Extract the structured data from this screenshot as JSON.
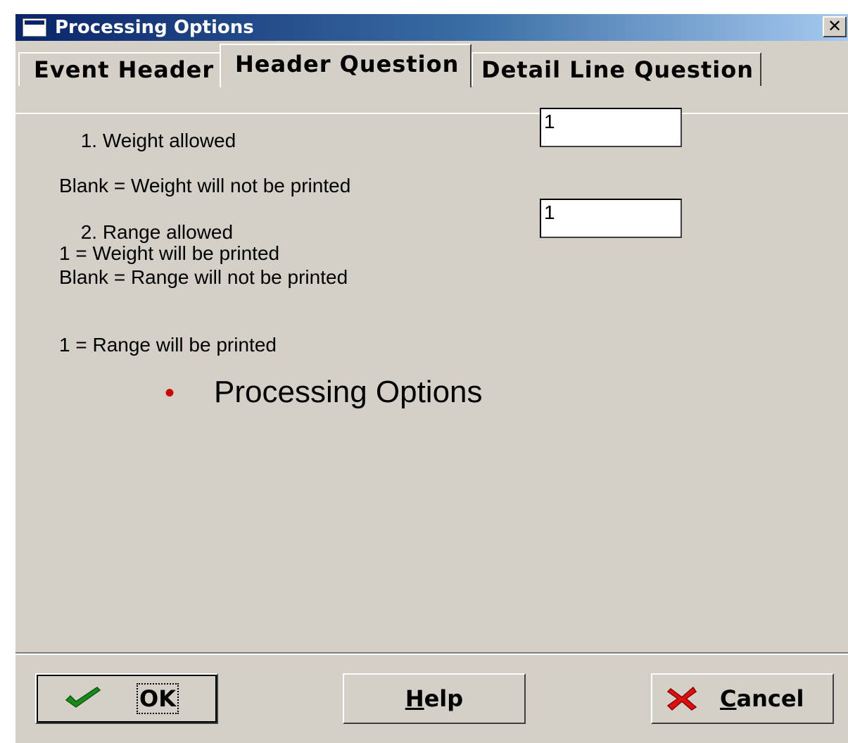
{
  "window": {
    "title": "Processing Options",
    "close_glyph": "✕"
  },
  "tabs": [
    {
      "label": "Event Header",
      "selected": false
    },
    {
      "label": "Header Question",
      "selected": true
    },
    {
      "label": "Detail Line Question",
      "selected": false
    }
  ],
  "options": [
    {
      "title": "1. Weight allowed",
      "line1": "Blank = Weight will not be printed",
      "line2": "1 = Weight will be printed",
      "value": "1"
    },
    {
      "title": "2. Range allowed",
      "line1": "Blank = Range will not be printed",
      "line2": "1 = Range will be printed",
      "value": "1"
    }
  ],
  "overlay": {
    "bullet": "•",
    "text": "Processing Options",
    "bullet_color": "#cc0000"
  },
  "buttons": {
    "ok": {
      "label": "OK",
      "icon": "checkmark-icon"
    },
    "help": {
      "mnemonic": "H",
      "rest": "elp"
    },
    "cancel": {
      "mnemonic": "C",
      "rest": "ancel",
      "icon": "red-x-icon"
    }
  },
  "colors": {
    "title_gradient_start": "#0a246a",
    "face": "#d4d0c8"
  }
}
